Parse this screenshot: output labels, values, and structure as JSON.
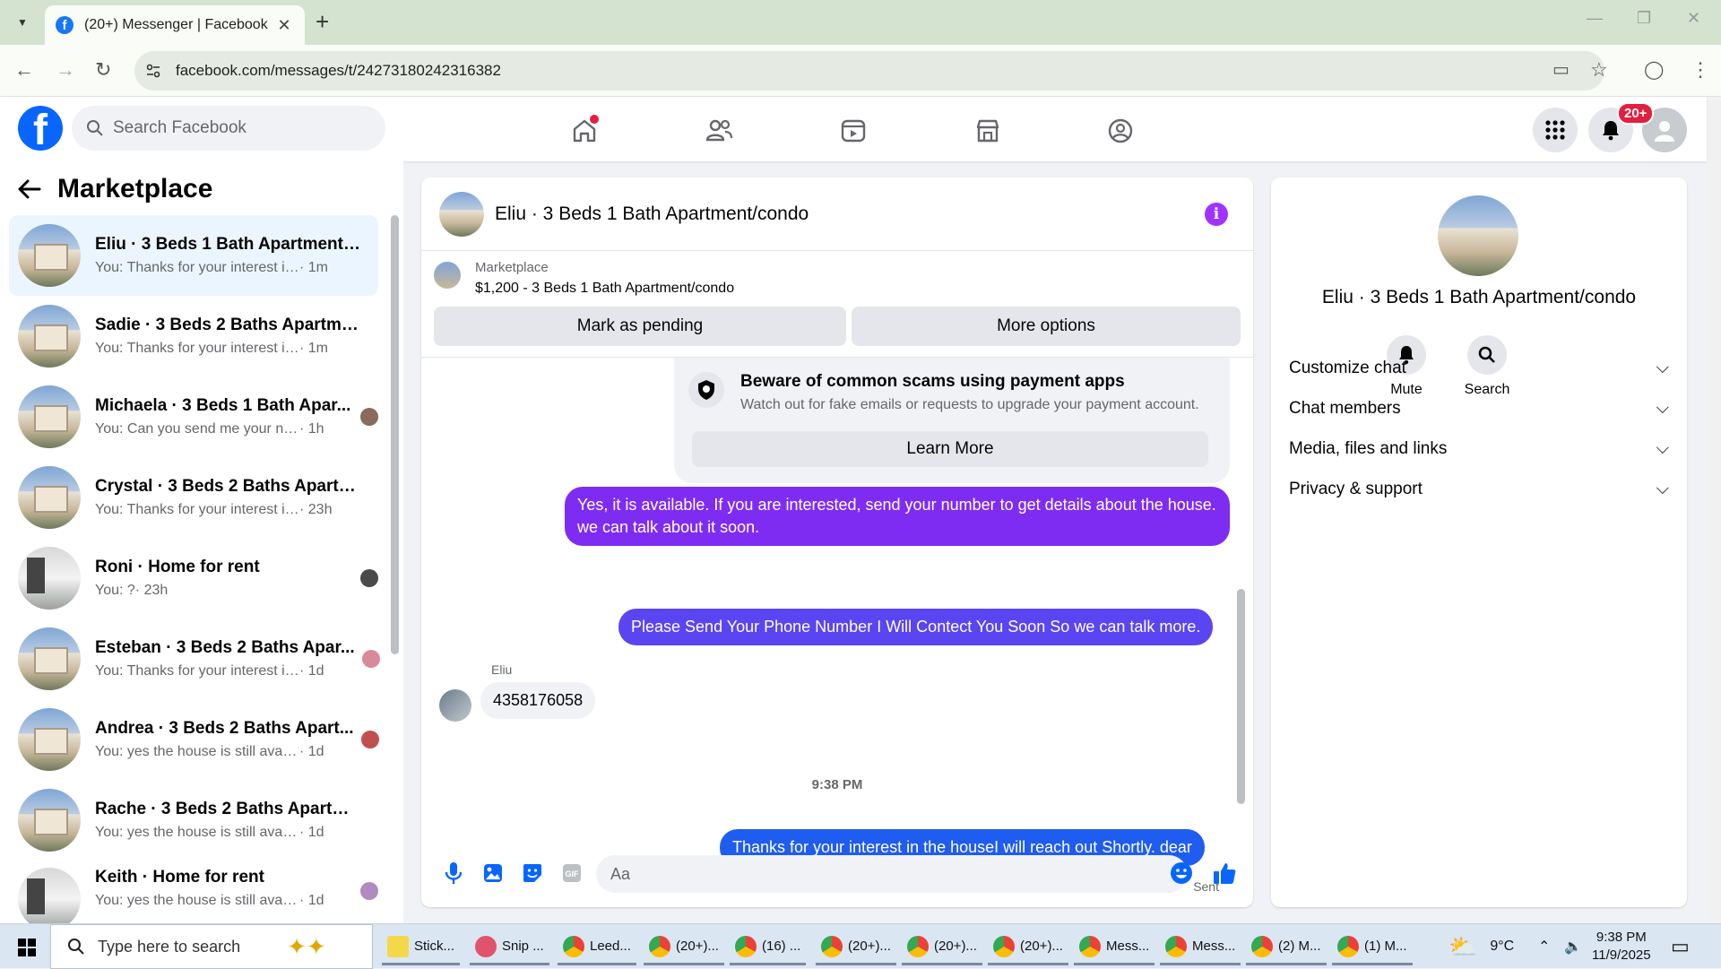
{
  "browser": {
    "tab_title": "(20+) Messenger | Facebook",
    "url": "facebook.com/messages/t/24273180242316382"
  },
  "header": {
    "search_placeholder": "Search Facebook",
    "notification_badge": "20+"
  },
  "sidebar": {
    "title": "Marketplace",
    "conversations": [
      {
        "name": "Eliu · 3 Beds 1 Bath Apartment/c...",
        "preview": "You: Thanks for your interest in the...",
        "time": "· 1m"
      },
      {
        "name": "Sadie · 3 Beds 2 Baths Apartmen...",
        "preview": "You: Thanks for your interest in the...",
        "time": "· 1m"
      },
      {
        "name": "Michaela · 3 Beds 1 Bath Apar...",
        "preview": "You: Can you send me your num...",
        "time": "· 1h"
      },
      {
        "name": "Crystal · 3 Beds 2 Baths Apartm...",
        "preview": "You: Thanks for your interest in th...",
        "time": "· 23h"
      },
      {
        "name": "Roni · Home for rent",
        "preview": "You: ?",
        "time": "· 23h"
      },
      {
        "name": "Esteban · 3 Beds 2 Baths Apar...",
        "preview": "You: Thanks for your interest in t...",
        "time": "· 1d"
      },
      {
        "name": "Andrea · 3 Beds 2 Baths Apart...",
        "preview": "You: yes the house is still availab...",
        "time": "· 1d"
      },
      {
        "name": "Rache · 3 Beds 2 Baths Apartme...",
        "preview": "You: yes the house is still available f...",
        "time": "· 1d"
      },
      {
        "name": "Keith · Home for rent",
        "preview": "You: yes the house is still availab...",
        "time": "· 1d"
      }
    ]
  },
  "chat": {
    "title": "Eliu · 3 Beds 1 Bath Apartment/condo",
    "marketplace_label": "Marketplace",
    "listing": "$1,200 - 3 Beds 1 Bath Apartment/condo",
    "mark_pending": "Mark as pending",
    "more_options": "More options",
    "warning_title": "Beware of common scams using payment apps",
    "warning_sub": "Watch out for fake emails or requests to upgrade your payment account.",
    "learn_more": "Learn More",
    "msg1": "Yes, it is available. If you are interested, send your number to get details about the house. we can talk about it soon.",
    "msg2": "Please Send Your Phone Number I Will Contect You Soon So we can talk more.",
    "sender": "Eliu",
    "incoming": "4358176058",
    "timestamp": "9:38 PM",
    "msg3": "Thanks for your interest in the houseI will reach out Shortly. dear",
    "sent_label": "Sent",
    "input_placeholder": "Aa"
  },
  "info_panel": {
    "name": "Eliu · 3 Beds 1 Bath Apartment/condo",
    "mute": "Mute",
    "search": "Search",
    "sections": [
      "Customize chat",
      "Chat members",
      "Media, files and links",
      "Privacy & support"
    ]
  },
  "taskbar": {
    "search_placeholder": "Type here to search",
    "apps": [
      "Stick...",
      "Snip ...",
      "Leed...",
      "(20+)...",
      "(16) ...",
      "(20+)...",
      "(20+)...",
      "(20+)...",
      "Mess...",
      "Mess...",
      "(2) M...",
      "(1) M..."
    ],
    "weather": "9°C",
    "time": "9:38 PM",
    "date": "11/9/2025"
  },
  "colors": {
    "fb_blue": "#0866ff",
    "bubble1": "#7f2cf2",
    "bubble2": "#5b44f2",
    "bubble3": "#1f5cf0"
  }
}
